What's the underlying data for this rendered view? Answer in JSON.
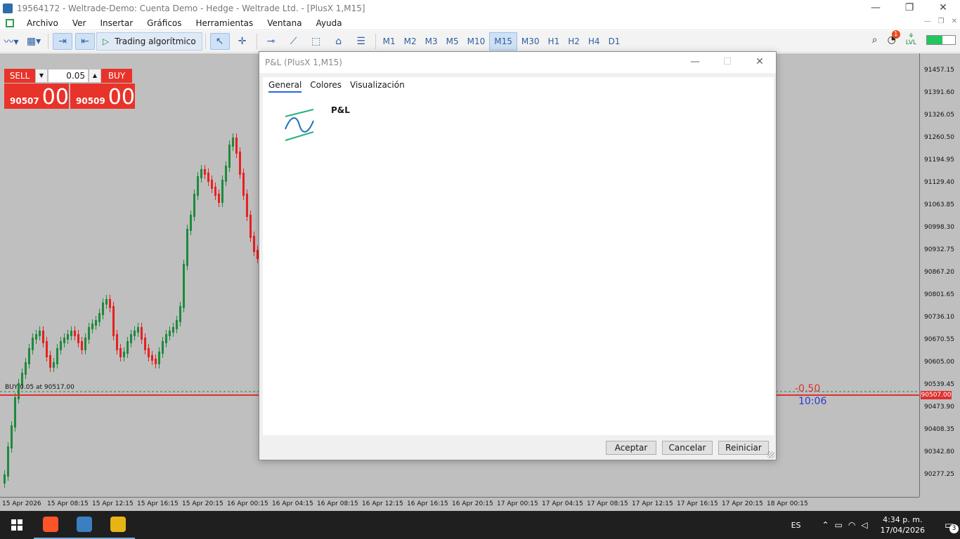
{
  "window": {
    "title": "19564172 - Weltrade-Demo: Cuenta Demo - Hedge - Weltrade Ltd. - [PlusX 1,M15]",
    "minimize": "—",
    "maximize": "❐",
    "close": "✕"
  },
  "menu": {
    "items": [
      "Archivo",
      "Ver",
      "Insertar",
      "Gráficos",
      "Herramientas",
      "Ventana",
      "Ayuda"
    ]
  },
  "toolbar": {
    "algo_trading_label": "Trading algorítmico",
    "timeframes": [
      "M1",
      "M2",
      "M3",
      "M5",
      "M10",
      "M15",
      "M30",
      "H1",
      "H2",
      "H4",
      "D1"
    ],
    "active_timeframe": "M15",
    "notification_count": "1",
    "lvl_label": "LVL"
  },
  "trade_panel": {
    "sell_label": "SELL",
    "buy_label": "BUY",
    "lot_value": "0.05",
    "sell_price_main": "90507",
    "sell_price_big": "00",
    "buy_price_main": "90509",
    "buy_price_big": "00"
  },
  "chart": {
    "price_labels": [
      "91457.15",
      "91391.60",
      "91326.05",
      "91260.50",
      "91194.95",
      "91129.40",
      "91063.85",
      "90998.30",
      "90932.75",
      "90867.20",
      "90801.65",
      "90736.10",
      "90670.55",
      "90605.00",
      "90539.45",
      "90473.90",
      "90408.35",
      "90342.80",
      "90277.25"
    ],
    "current_price": "90507.00",
    "time_labels": [
      "15 Apr 2026",
      "15 Apr 08:15",
      "15 Apr 12:15",
      "15 Apr 16:15",
      "15 Apr 20:15",
      "16 Apr 00:15",
      "16 Apr 04:15",
      "16 Apr 08:15",
      "16 Apr 12:15",
      "16 Apr 16:15",
      "16 Apr 20:15",
      "17 Apr 00:15",
      "17 Apr 04:15",
      "17 Apr 08:15",
      "17 Apr 12:15",
      "17 Apr 16:15",
      "17 Apr 20:15",
      "18 Apr 00:15"
    ],
    "order_label": "BUY 0.05 at 90517.00",
    "pl_value": "-0.50",
    "timer_value": "10:06",
    "colors": {
      "bull": "#1e8a3c",
      "bear": "#e82020",
      "background": "#bfbfbf",
      "price_line": "#e03030"
    }
  },
  "dialog": {
    "title": "P&L (PlusX 1,M15)",
    "tabs": [
      "General",
      "Colores",
      "Visualización"
    ],
    "indicator_name": "P&L",
    "ok_label": "Aceptar",
    "cancel_label": "Cancelar",
    "reset_label": "Reiniciar"
  },
  "taskbar": {
    "language": "ES",
    "time": "4:34 p. m.",
    "date": "17/04/2026",
    "notifications": "3"
  }
}
